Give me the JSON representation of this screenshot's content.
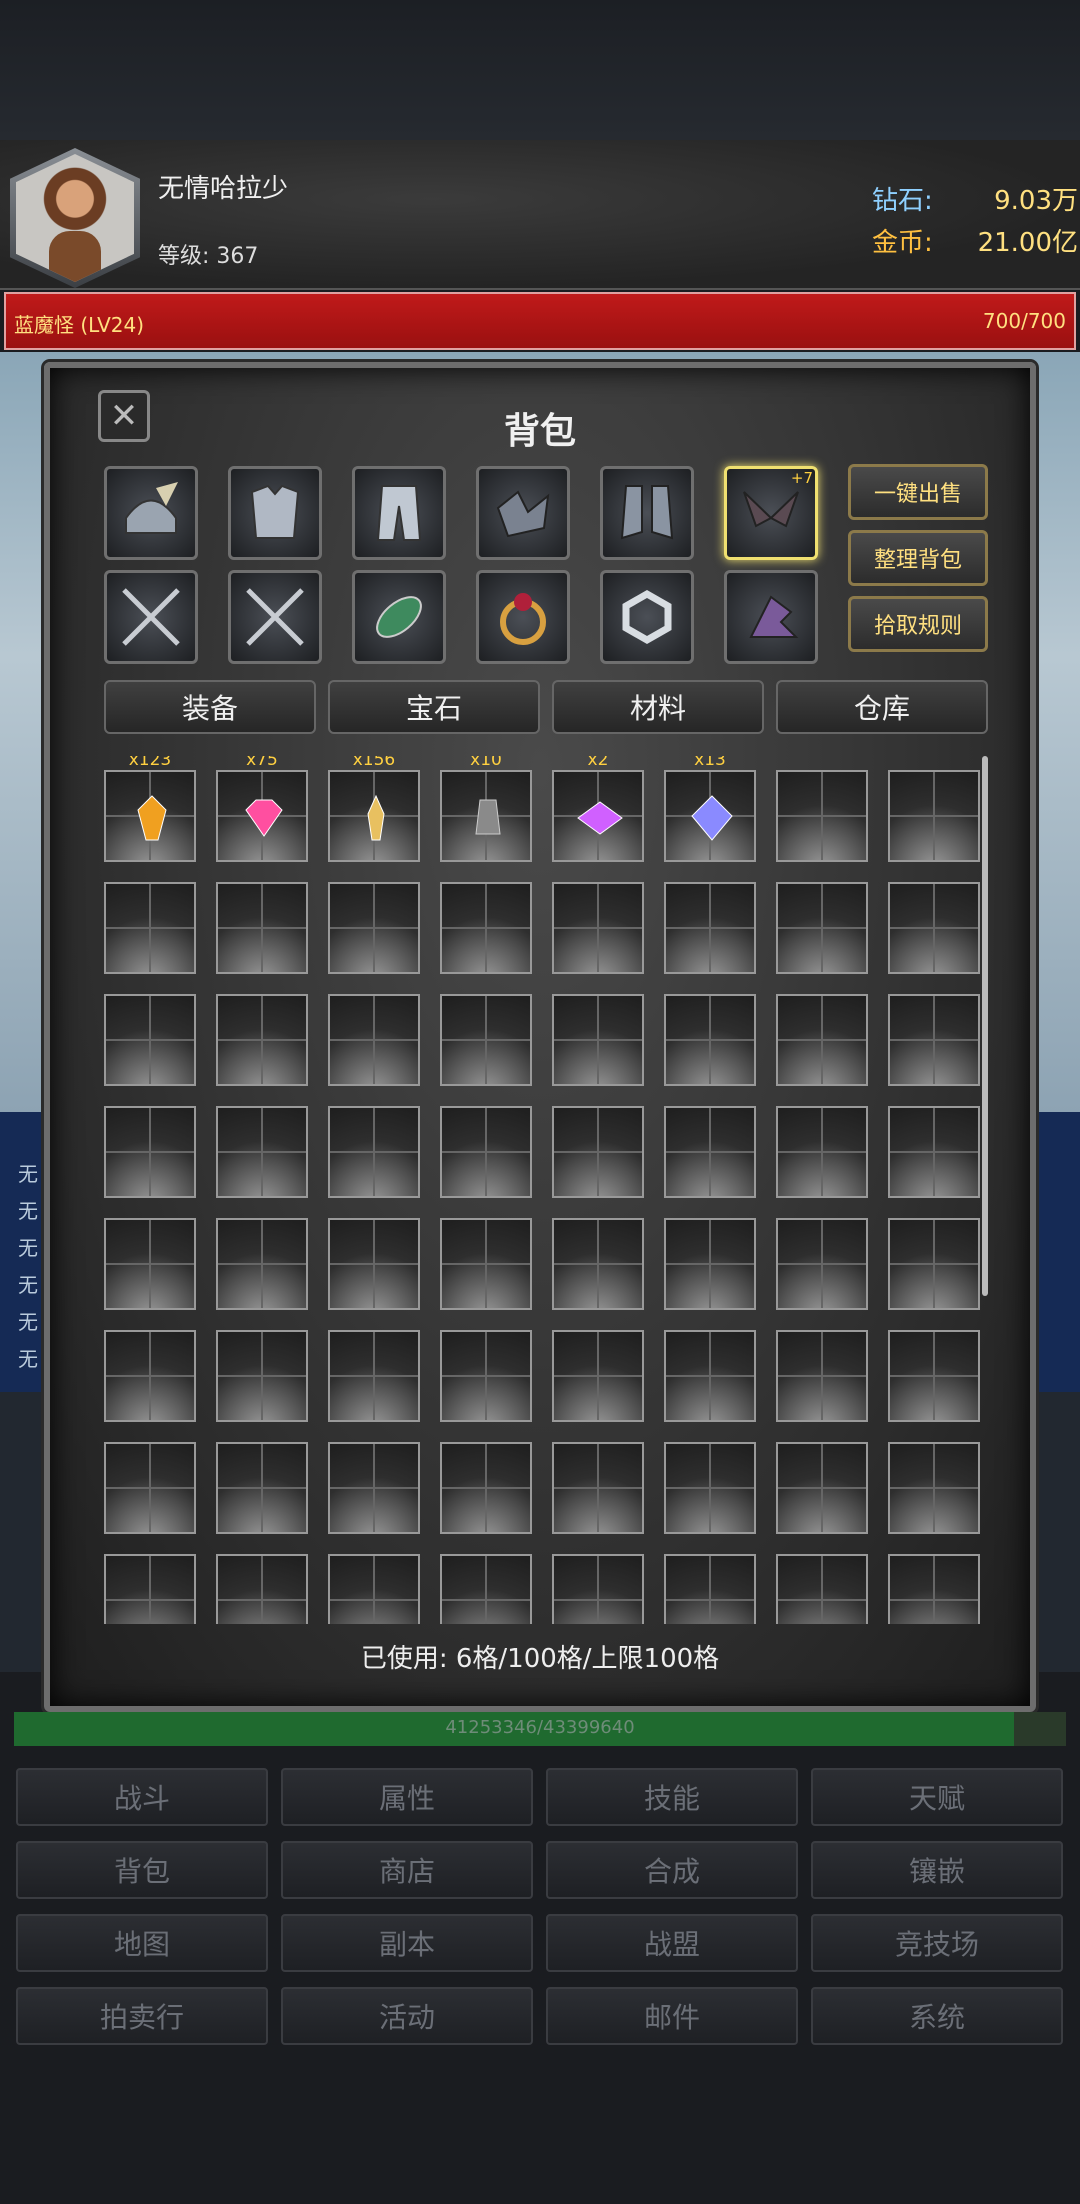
{
  "player": {
    "name": "无情哈拉少",
    "level_label": "等级: 367"
  },
  "resources": {
    "diamond_label": "钻石:",
    "diamond_value": "9.03万",
    "gold_label": "金币:",
    "gold_value": "21.00亿"
  },
  "boss": {
    "name": "蓝魔怪 (LV24)",
    "hp": "700/700"
  },
  "background_log": [
    "无",
    "无",
    "无",
    "无",
    "无",
    "无"
  ],
  "panel": {
    "title": "背包",
    "close_icon": "close-icon",
    "equipment": [
      {
        "icon": "helmet-icon",
        "selected": false
      },
      {
        "icon": "armor-icon",
        "selected": false
      },
      {
        "icon": "pants-icon",
        "selected": false
      },
      {
        "icon": "gloves-icon",
        "selected": false
      },
      {
        "icon": "boots-icon",
        "selected": false
      },
      {
        "icon": "wings-icon",
        "selected": true,
        "badge": "+7"
      },
      {
        "icon": "crossed-swords-icon",
        "selected": false
      },
      {
        "icon": "crossed-swords-icon",
        "selected": false
      },
      {
        "icon": "green-gem-icon",
        "selected": false
      },
      {
        "icon": "ring-icon",
        "selected": false
      },
      {
        "icon": "hex-ring-icon",
        "selected": false
      },
      {
        "icon": "dragon-pet-icon",
        "selected": false
      }
    ],
    "side_buttons": [
      "一键出售",
      "整理背包",
      "拾取规则"
    ],
    "tabs": [
      {
        "label": "装备",
        "active": false
      },
      {
        "label": "宝石",
        "active": true
      },
      {
        "label": "材料",
        "active": false
      },
      {
        "label": "仓库",
        "active": false
      }
    ],
    "items": [
      {
        "count": "x123",
        "icon": "orange-crystal-icon",
        "color": "#f0a020"
      },
      {
        "count": "x75",
        "icon": "pink-gem-icon",
        "color": "#ff4fa0"
      },
      {
        "count": "x156",
        "icon": "gold-shard-icon",
        "color": "#e8c060"
      },
      {
        "count": "x10",
        "icon": "gray-stone-icon",
        "color": "#8a8a8a"
      },
      {
        "count": "x2",
        "icon": "purple-gem-icon",
        "color": "#d060ff"
      },
      {
        "count": "x13",
        "icon": "blue-diamond-icon",
        "color": "#8a8aff"
      }
    ],
    "usage": "已使用:  6格/100格/上限100格"
  },
  "xp": {
    "text": "41253346/43399640",
    "current": 41253346,
    "max": 43399640
  },
  "menu": [
    "战斗",
    "属性",
    "技能",
    "天赋",
    "背包",
    "商店",
    "合成",
    "镶嵌",
    "地图",
    "副本",
    "战盟",
    "竞技场",
    "拍卖行",
    "活动",
    "邮件",
    "系统"
  ]
}
